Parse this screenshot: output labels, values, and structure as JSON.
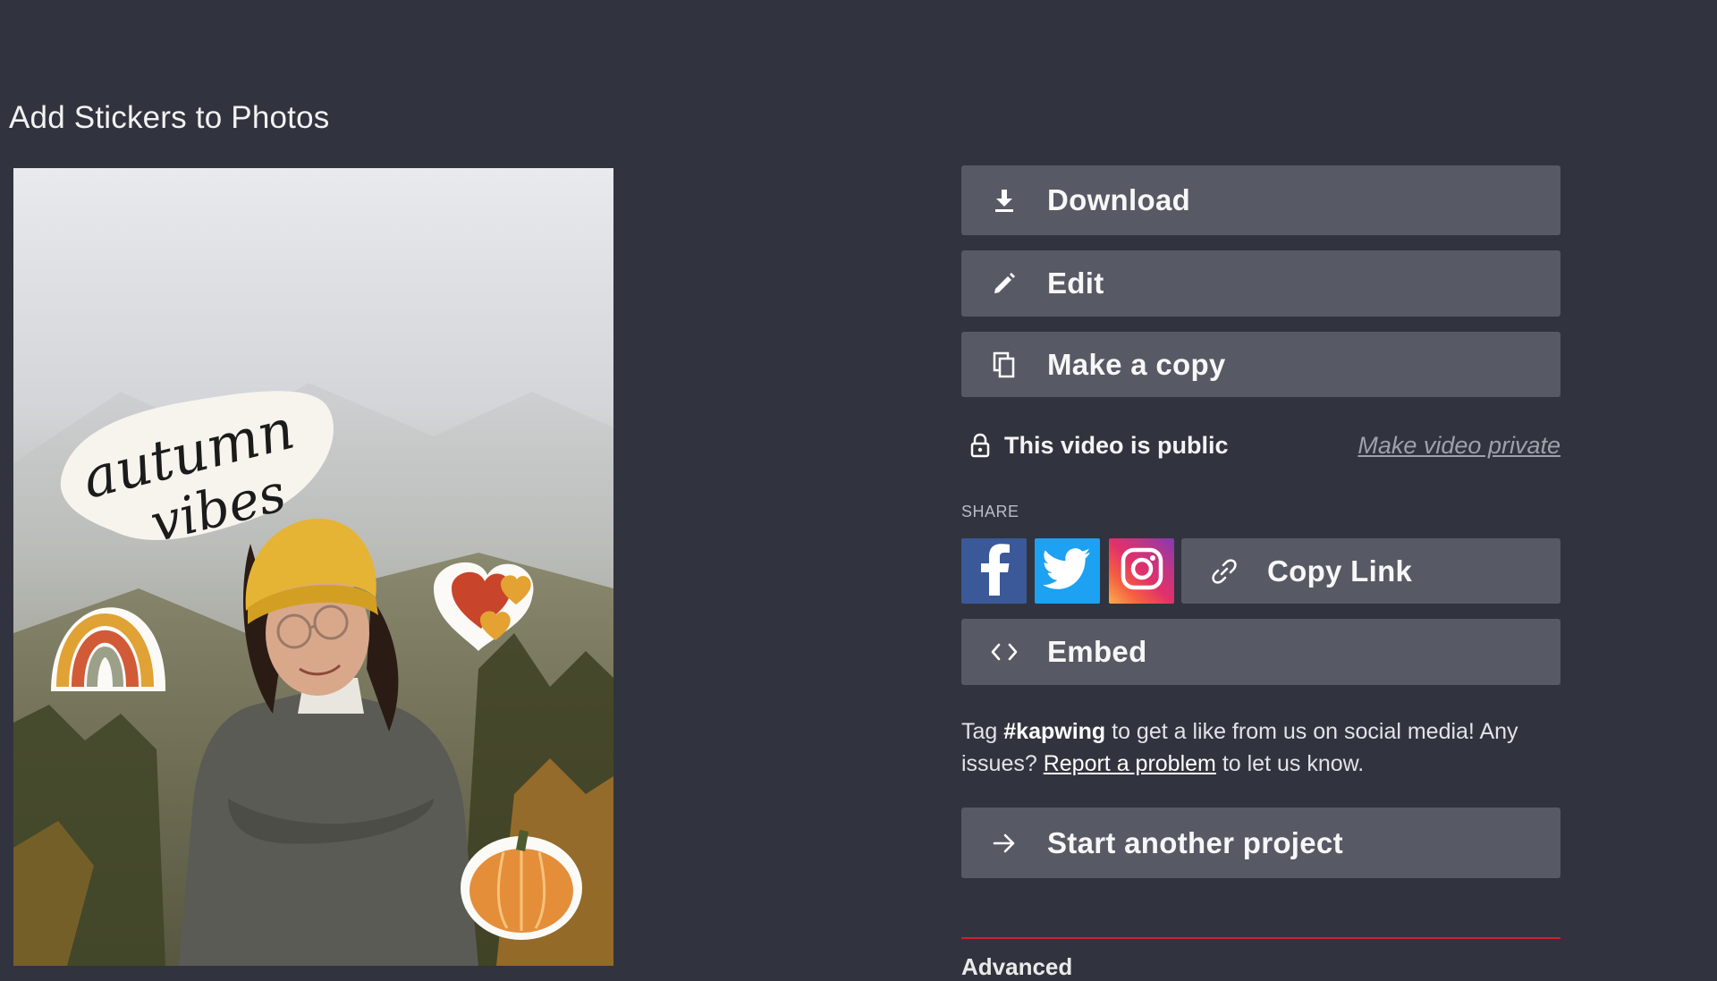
{
  "page": {
    "title": "Add Stickers to Photos"
  },
  "preview": {
    "sticker_text_line1": "autumn",
    "sticker_text_line2": "vibes"
  },
  "actions": {
    "download_label": "Download",
    "edit_label": "Edit",
    "copy_label": "Make a copy"
  },
  "privacy": {
    "status": "This video is public",
    "toggle_label": "Make video private"
  },
  "share": {
    "heading": "SHARE",
    "networks": [
      "facebook-icon",
      "twitter-icon",
      "instagram-icon"
    ],
    "copy_link_label": "Copy Link",
    "embed_label": "Embed"
  },
  "info": {
    "prefix": "Tag ",
    "hashtag": "#kapwing",
    "middle": " to get a like from us on social media! Any issues? ",
    "report_link": "Report a problem",
    "suffix": " to let us know."
  },
  "start_label": "Start another project",
  "below_label": "Advanced",
  "colors": {
    "background": "#31343f",
    "button": "#575a64",
    "accent_rule": "#d0202a",
    "facebook": "#3b5998",
    "twitter": "#1da1f2"
  }
}
